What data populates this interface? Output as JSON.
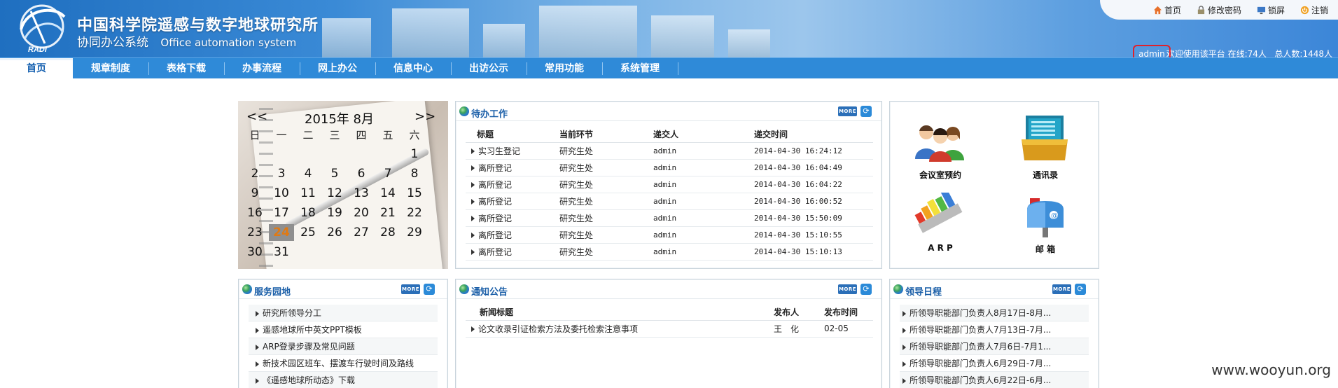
{
  "header": {
    "org_title": "中国科学院遥感与数字地球研究所",
    "sys_title_cn": "协同办公系统",
    "sys_title_en": "Office automation system",
    "logo_text": "RADI",
    "toplinks": [
      {
        "label": "首页",
        "icon": "home-icon"
      },
      {
        "label": "修改密码",
        "icon": "lock-icon"
      },
      {
        "label": "锁屏",
        "icon": "monitor-icon"
      },
      {
        "label": "注销",
        "icon": "power-icon"
      }
    ]
  },
  "nav": {
    "items": [
      "首页",
      "规章制度",
      "表格下载",
      "办事流程",
      "网上办公",
      "信息中心",
      "出访公示",
      "常用功能",
      "系统管理"
    ],
    "active": 0
  },
  "userbar": {
    "username": "admin",
    "welcome": "欢迎使用该平台",
    "online_label": "在线:",
    "online_count": "74",
    "online_unit": "人",
    "total_label": "总人数:",
    "total_count": "1448",
    "total_unit": "人"
  },
  "calendar": {
    "prev": "<<",
    "next": ">>",
    "month_label": "2015年 8月",
    "weekdays": [
      "日",
      "一",
      "二",
      "三",
      "四",
      "五",
      "六"
    ],
    "weeks": [
      [
        "",
        "",
        "",
        "",
        "",
        "",
        "1"
      ],
      [
        "2",
        "3",
        "4",
        "5",
        "6",
        "7",
        "8"
      ],
      [
        "9",
        "10",
        "11",
        "12",
        "13",
        "14",
        "15"
      ],
      [
        "16",
        "17",
        "18",
        "19",
        "20",
        "21",
        "22"
      ],
      [
        "23",
        "24",
        "25",
        "26",
        "27",
        "28",
        "29"
      ],
      [
        "30",
        "31",
        "",
        "",
        "",
        "",
        ""
      ]
    ],
    "today": "24"
  },
  "todo": {
    "title": "待办工作",
    "more": "MORE",
    "headers": [
      "标题",
      "当前环节",
      "递交人",
      "递交时间"
    ],
    "rows": [
      [
        "实习生登记",
        "研究生处",
        "admin",
        "2014-04-30 16:24:12"
      ],
      [
        "离所登记",
        "研究生处",
        "admin",
        "2014-04-30 16:04:49"
      ],
      [
        "离所登记",
        "研究生处",
        "admin",
        "2014-04-30 16:04:22"
      ],
      [
        "离所登记",
        "研究生处",
        "admin",
        "2014-04-30 16:00:52"
      ],
      [
        "离所登记",
        "研究生处",
        "admin",
        "2014-04-30 15:50:09"
      ],
      [
        "离所登记",
        "研究生处",
        "admin",
        "2014-04-30 15:10:55"
      ],
      [
        "离所登记",
        "研究生处",
        "admin",
        "2014-04-30 15:10:13"
      ]
    ]
  },
  "quick": {
    "items": [
      {
        "label": "会议室预约",
        "icon": "meeting-room-icon"
      },
      {
        "label": "通讯录",
        "icon": "address-book-icon"
      },
      {
        "label": "A R P",
        "icon": "arp-icon"
      },
      {
        "label": "邮 箱",
        "icon": "mailbox-icon"
      }
    ]
  },
  "service": {
    "title": "服务园地",
    "more": "MORE",
    "items": [
      "研究所领导分工",
      "遥感地球所中英文PPT模板",
      "ARP登录步骤及常见问题",
      "新技术园区班车、摆渡车行驶时间及路线",
      "《遥感地球所动态》下载"
    ]
  },
  "notice": {
    "title": "通知公告",
    "more": "MORE",
    "headers": [
      "新闻标题",
      "发布人",
      "发布时间"
    ],
    "rows": [
      [
        "论文收录引证检索方法及委托检索注意事项",
        "王　化",
        "02-05"
      ]
    ]
  },
  "leader": {
    "title": "领导日程",
    "more": "MORE",
    "items": [
      "所领导职能部门负责人8月17日-8月...",
      "所领导职能部门负责人7月13日-7月...",
      "所领导职能部门负责人7月6日-7月1...",
      "所领导职能部门负责人6月29日-7月...",
      "所领导职能部门负责人6月22日-6月..."
    ]
  },
  "watermark": "www.wooyun.org"
}
